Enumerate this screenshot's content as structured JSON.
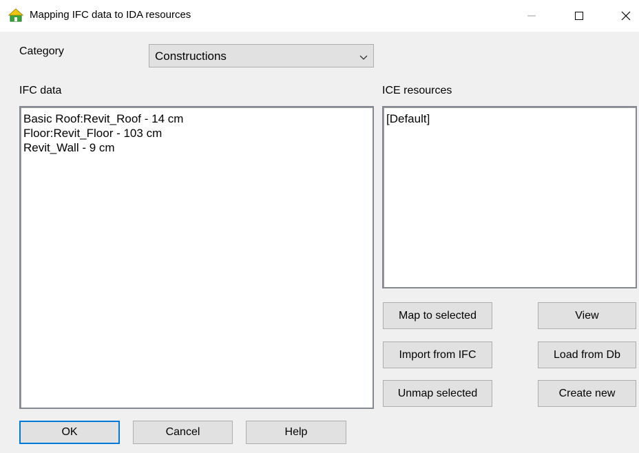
{
  "window": {
    "title": "Mapping IFC data to IDA resources",
    "app_icon": "house-icon",
    "controls": [
      "minimize-icon",
      "maximize-icon",
      "close-icon"
    ]
  },
  "category": {
    "label": "Category",
    "selected": "Constructions"
  },
  "ifc": {
    "label": "IFC data",
    "items": [
      "Basic Roof:Revit_Roof - 14 cm",
      "Floor:Revit_Floor - 103 cm",
      "Revit_Wall - 9 cm"
    ]
  },
  "ice": {
    "label": "ICE resources",
    "items": [
      "[Default]"
    ]
  },
  "actions": {
    "map_selected": "Map to selected",
    "view": "View",
    "import_ifc": "Import from IFC",
    "load_db": "Load from Db",
    "unmap_selected": "Unmap selected",
    "create_new": "Create new"
  },
  "footer": {
    "ok": "OK",
    "cancel": "Cancel",
    "help": "Help"
  },
  "colors": {
    "icon_green": "#3aa53a",
    "focus_border": "#0078d7"
  }
}
